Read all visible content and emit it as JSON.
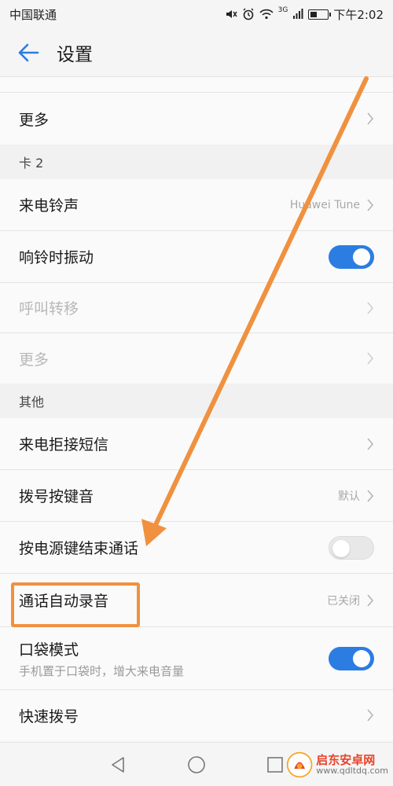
{
  "status_bar": {
    "carrier": "中国联通",
    "network": "3G",
    "time": "下午2:02"
  },
  "header": {
    "title": "设置"
  },
  "rows": {
    "more1": {
      "label": "更多"
    },
    "card2_header": "卡 2",
    "ringtone": {
      "label": "来电铃声",
      "value": "Huawei Tune"
    },
    "vibrate": {
      "label": "响铃时振动",
      "state": "on"
    },
    "forward": {
      "label": "呼叫转移"
    },
    "more2": {
      "label": "更多"
    },
    "other_header": "其他",
    "reject_sms": {
      "label": "来电拒接短信"
    },
    "dial_tone": {
      "label": "拨号按键音",
      "value": "默认"
    },
    "power_end": {
      "label": "按电源键结束通话",
      "state": "off"
    },
    "auto_record": {
      "label": "通话自动录音",
      "value": "已关闭"
    },
    "pocket": {
      "label": "口袋模式",
      "sub": "手机置于口袋时，增大来电音量",
      "state": "on"
    },
    "speed_dial": {
      "label": "快速拨号"
    }
  },
  "watermark": {
    "title": "启东安卓网",
    "url": "www.qdltdq.com"
  },
  "colors": {
    "accent": "#2b7de1",
    "annotation": "#f0913f"
  }
}
